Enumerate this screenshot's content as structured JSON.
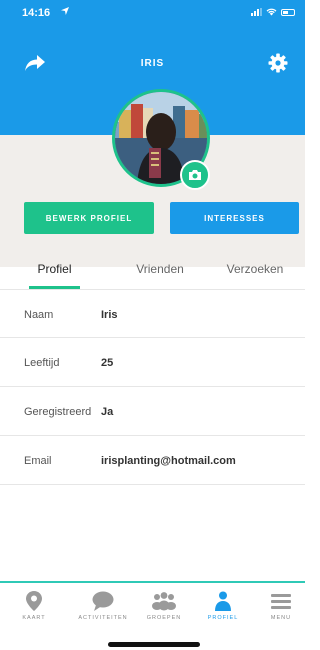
{
  "status_bar": {
    "time": "14:16",
    "arrow_icon": "location-arrow-icon"
  },
  "header": {
    "title": "IRIS",
    "share_icon": "share-arrow-icon",
    "settings_icon": "gear-icon",
    "color": "#1a9ae8"
  },
  "profile": {
    "camera_icon": "camera-icon",
    "accent": "#1ec28b"
  },
  "buttons": {
    "edit": "BEWERK PROFIEL",
    "interests": "INTERESSES"
  },
  "tabs": [
    {
      "label": "Profiel",
      "active": true
    },
    {
      "label": "Vrienden",
      "active": false
    },
    {
      "label": "Verzoeken",
      "active": false
    }
  ],
  "details": [
    {
      "label": "Naam",
      "value": "Iris"
    },
    {
      "label": "Leeftijd",
      "value": "25"
    },
    {
      "label": "Geregistreerd",
      "value": "Ja"
    },
    {
      "label": "Email",
      "value": "irisplanting@hotmail.com"
    }
  ],
  "bottom_nav": [
    {
      "label": "KAART",
      "icon": "map-pin-icon",
      "active": false
    },
    {
      "label": "ACTIVITEITEN",
      "icon": "speech-bubble-icon",
      "active": false
    },
    {
      "label": "GROEPEN",
      "icon": "group-icon",
      "active": false
    },
    {
      "label": "PROFIEL",
      "icon": "person-icon",
      "active": true
    },
    {
      "label": "MENU",
      "icon": "hamburger-menu-icon",
      "active": false
    }
  ]
}
